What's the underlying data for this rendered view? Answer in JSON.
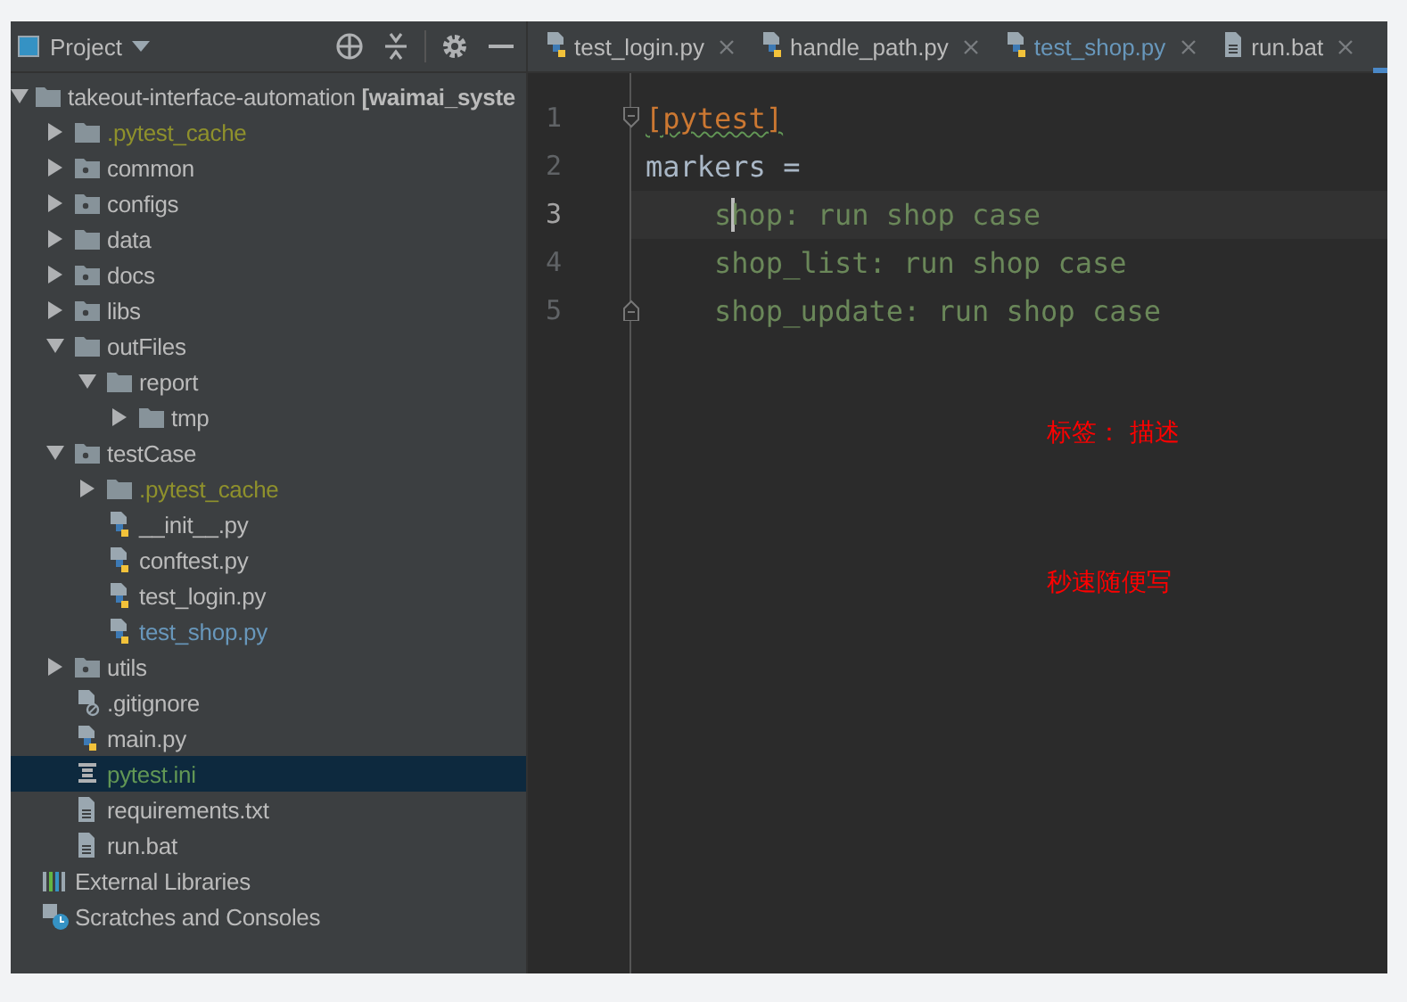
{
  "project_panel": {
    "title": "Project",
    "tree": [
      {
        "label": "takeout-interface-automation **[waimai_syste**",
        "kind": "module",
        "expanded": true,
        "selected": false,
        "color": "#bbbbbb",
        "children": [
          {
            "label": ".pytest_cache",
            "kind": "folder",
            "expanded": false,
            "selected": false,
            "color": "#8f912c"
          },
          {
            "label": "common",
            "kind": "package",
            "expanded": false,
            "selected": false,
            "color": "#bbbbbb"
          },
          {
            "label": "configs",
            "kind": "package",
            "expanded": false,
            "selected": false,
            "color": "#bbbbbb"
          },
          {
            "label": "data",
            "kind": "folder",
            "expanded": false,
            "selected": false,
            "color": "#bbbbbb"
          },
          {
            "label": "docs",
            "kind": "package",
            "expanded": false,
            "selected": false,
            "color": "#bbbbbb"
          },
          {
            "label": "libs",
            "kind": "package",
            "expanded": false,
            "selected": false,
            "color": "#bbbbbb"
          },
          {
            "label": "outFiles",
            "kind": "folder",
            "expanded": true,
            "selected": false,
            "color": "#bbbbbb",
            "children": [
              {
                "label": "report",
                "kind": "folder",
                "expanded": true,
                "selected": false,
                "color": "#bbbbbb",
                "children": [
                  {
                    "label": "tmp",
                    "kind": "folder",
                    "expanded": false,
                    "selected": false,
                    "color": "#bbbbbb"
                  }
                ]
              }
            ]
          },
          {
            "label": "testCase",
            "kind": "package",
            "expanded": true,
            "selected": false,
            "color": "#bbbbbb",
            "children": [
              {
                "label": ".pytest_cache",
                "kind": "folder",
                "expanded": false,
                "selected": false,
                "color": "#8f912c"
              },
              {
                "label": "__init__.py",
                "kind": "python",
                "selected": false,
                "color": "#bbbbbb"
              },
              {
                "label": "conftest.py",
                "kind": "python",
                "selected": false,
                "color": "#bbbbbb"
              },
              {
                "label": "test_login.py",
                "kind": "python",
                "selected": false,
                "color": "#bbbbbb"
              },
              {
                "label": "test_shop.py",
                "kind": "python",
                "selected": false,
                "color": "#6897bb"
              }
            ]
          },
          {
            "label": "utils",
            "kind": "package",
            "expanded": false,
            "selected": false,
            "color": "#bbbbbb"
          },
          {
            "label": ".gitignore",
            "kind": "ignore",
            "selected": false,
            "color": "#bbbbbb"
          },
          {
            "label": "main.py",
            "kind": "python",
            "selected": false,
            "color": "#bbbbbb"
          },
          {
            "label": "pytest.ini",
            "kind": "ini",
            "selected": true,
            "color": "#629755"
          },
          {
            "label": "requirements.txt",
            "kind": "text",
            "selected": false,
            "color": "#bbbbbb"
          },
          {
            "label": "run.bat",
            "kind": "text",
            "selected": false,
            "color": "#bbbbbb"
          }
        ]
      },
      {
        "label": "External Libraries",
        "kind": "libraries",
        "selected": false,
        "color": "#bbbbbb"
      },
      {
        "label": "Scratches and Consoles",
        "kind": "scratches",
        "selected": false,
        "color": "#bbbbbb"
      }
    ]
  },
  "editor": {
    "tabs": [
      {
        "label": "test_login.py",
        "kind": "python",
        "color": "#bbbbbb"
      },
      {
        "label": "handle_path.py",
        "kind": "python",
        "color": "#bbbbbb"
      },
      {
        "label": "test_shop.py",
        "kind": "python",
        "color": "#6897bb"
      },
      {
        "label": "run.bat",
        "kind": "text",
        "color": "#bbbbbb"
      }
    ],
    "lines": [
      {
        "number": "1",
        "text": "[pytest]",
        "kind": "section",
        "current": false
      },
      {
        "number": "2",
        "text": "markers =",
        "kind": "key",
        "current": false
      },
      {
        "number": "3",
        "text": "    shop: run shop case",
        "kind": "value",
        "current": true
      },
      {
        "number": "4",
        "text": "    shop_list: run shop case",
        "kind": "value",
        "current": false
      },
      {
        "number": "5",
        "text": "    shop_update: run shop case",
        "kind": "value",
        "current": false
      }
    ],
    "notes": [
      "标签： 描述",
      "秒速随便写"
    ]
  }
}
